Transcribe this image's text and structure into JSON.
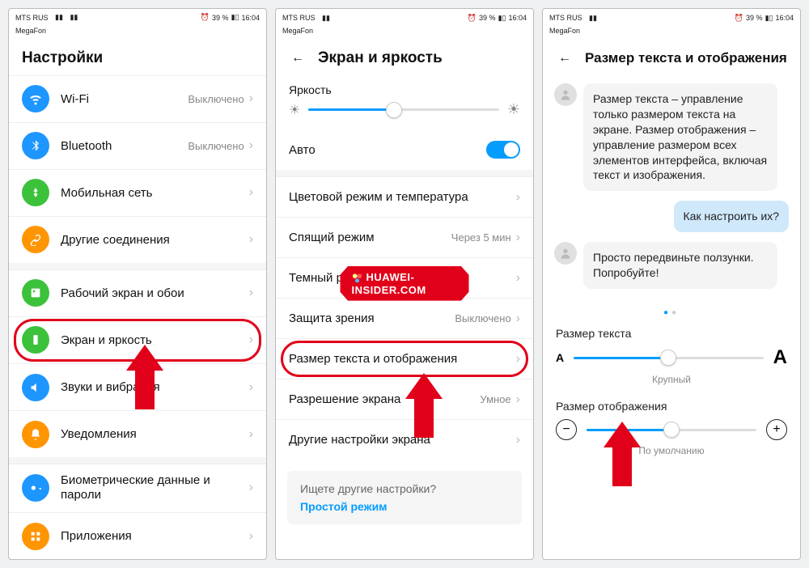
{
  "status": {
    "carrier": "MTS RUS",
    "sub": "MegaFon",
    "battery": "39 %",
    "time": "16:04"
  },
  "screen1": {
    "title": "Настройки",
    "items": [
      {
        "label": "Wi-Fi",
        "value": "Выключено",
        "color": "#1e96ff"
      },
      {
        "label": "Bluetooth",
        "value": "Выключено",
        "color": "#1e96ff"
      },
      {
        "label": "Мобильная сеть",
        "value": "",
        "color": "#3cc13b"
      },
      {
        "label": "Другие соединения",
        "value": "",
        "color": "#ff9500"
      },
      {
        "label": "Рабочий экран и обои",
        "value": "",
        "color": "#3cc13b"
      },
      {
        "label": "Экран и яркость",
        "value": "",
        "color": "#3cc13b"
      },
      {
        "label": "Звуки и вибрация",
        "value": "",
        "color": "#1e96ff"
      },
      {
        "label": "Уведомления",
        "value": "",
        "color": "#ff9500"
      },
      {
        "label": "Биометрические данные и пароли",
        "value": "",
        "color": "#1e96ff"
      },
      {
        "label": "Приложения",
        "value": "",
        "color": "#ff9500"
      }
    ]
  },
  "screen2": {
    "title": "Экран и яркость",
    "brightness_label": "Яркость",
    "auto_label": "Авто",
    "items": [
      {
        "label": "Цветовой режим и температура",
        "value": ""
      },
      {
        "label": "Спящий режим",
        "value": "Через 5 мин"
      },
      {
        "label": "Темный режим",
        "value": ""
      },
      {
        "label": "Защита зрения",
        "value": "Выключено"
      },
      {
        "label": "Размер текста и отображения",
        "value": ""
      },
      {
        "label": "Разрешение экрана",
        "value": "Умное"
      },
      {
        "label": "Другие настройки экрана",
        "value": ""
      }
    ],
    "hint_q": "Ищете другие настройки?",
    "hint_link": "Простой режим",
    "watermark": "HUAWEI-INSIDER.COM"
  },
  "screen3": {
    "title": "Размер текста и отображения",
    "msg1": "Размер текста – управление только размером текста на экране. Размер отображения – управление размером всех элементов интерфейса, включая текст и изображения.",
    "msg2": "Как настроить их?",
    "msg3": "Просто передвиньте ползунки. Попробуйте!",
    "text_size_label": "Размер текста",
    "text_size_caption": "Крупный",
    "display_size_label": "Размер отображения",
    "display_size_caption": "По умолчанию"
  }
}
